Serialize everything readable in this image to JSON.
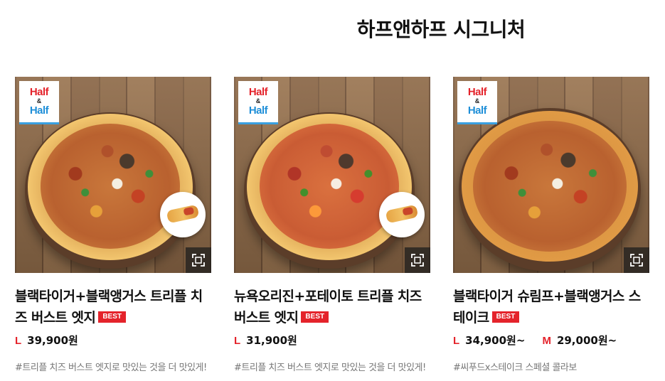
{
  "section": {
    "title": "하프앤하프 시그니처"
  },
  "logo": {
    "line1": "Half",
    "line2": "&",
    "line3": "Half"
  },
  "products": [
    {
      "name": "블랙타이거+블랙앵거스 트리플 치즈 버스트 엣지",
      "badge": "BEST",
      "prices": [
        {
          "size": "L",
          "price": "39,900원"
        }
      ],
      "description": "#트리플 치즈 버스트 엣지로 맛있는 것을 더 맛있게!"
    },
    {
      "name": "뉴욕오리진+포테이토 트리플 치즈 버스트 엣지",
      "badge": "BEST",
      "prices": [
        {
          "size": "L",
          "price": "31,900원"
        }
      ],
      "description": "#트리플 치즈 버스트 엣지로 맛있는 것을 더 맛있게!"
    },
    {
      "name": "블랙타이거 슈림프+블랙앵거스 스테이크",
      "badge": "BEST",
      "prices": [
        {
          "size": "L",
          "price": "34,900원~"
        },
        {
          "size": "M",
          "price": "29,000원~"
        }
      ],
      "description": "#씨푸드x스테이크 스페셜 콜라보"
    }
  ]
}
